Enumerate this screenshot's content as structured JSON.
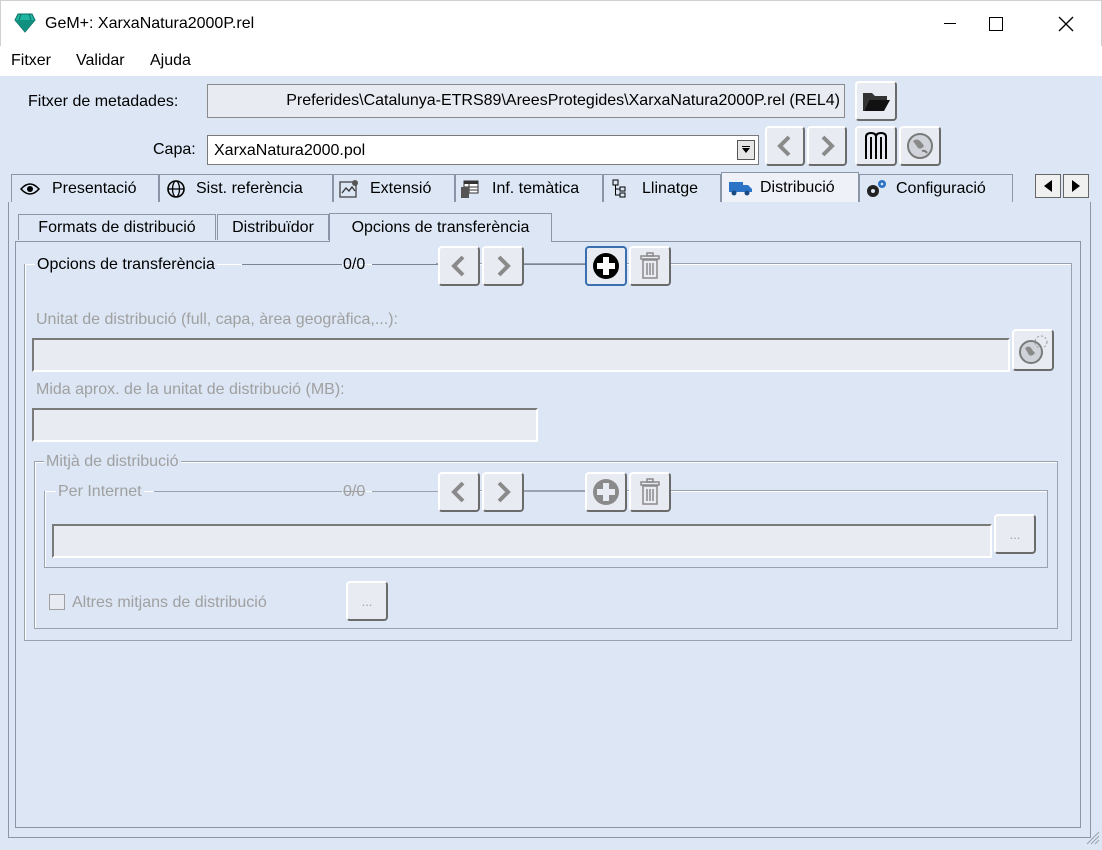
{
  "window": {
    "title": "GeM+: XarxaNatura2000P.rel"
  },
  "menu": {
    "items": [
      "Fitxer",
      "Validar",
      "Ajuda"
    ]
  },
  "metadata_file": {
    "label": "Fitxer de metadades:",
    "value": "Preferides\\Catalunya-ETRS89\\AreesProtegides\\XarxaNatura2000P.rel (REL4)"
  },
  "layer": {
    "label": "Capa:",
    "value": "XarxaNatura2000.pol"
  },
  "tabs": [
    {
      "label": "Presentació",
      "icon": "eye-icon"
    },
    {
      "label": "Sist. referència",
      "icon": "globe-icon"
    },
    {
      "label": "Extensió",
      "icon": "map-extent-icon"
    },
    {
      "label": "Inf. temàtica",
      "icon": "table-icon"
    },
    {
      "label": "Llinatge",
      "icon": "tree-icon"
    },
    {
      "label": "Distribució",
      "icon": "truck-icon"
    },
    {
      "label": "Configuració",
      "icon": "gears-icon"
    }
  ],
  "active_tab": "Distribució",
  "subtabs": [
    "Formats de distribució",
    "Distribuïdor",
    "Opcions de transferència"
  ],
  "active_subtab": "Opcions de transferència",
  "transfer": {
    "group_label": "Opcions de transferència",
    "counter": "0/0",
    "unit_label": "Unitat de distribució (full, capa, àrea geogràfica,...):",
    "size_label": "Mida aprox. de la unitat de distribució (MB):",
    "medium_group_label": "Mitjà de distribució",
    "internet_label": "Per Internet",
    "internet_counter": "0/0",
    "ellipsis": "...",
    "other_media_label": "Altres mitjans de distribució"
  },
  "colors": {
    "background": "#dce6f4",
    "accent": "#1a9f8f"
  }
}
